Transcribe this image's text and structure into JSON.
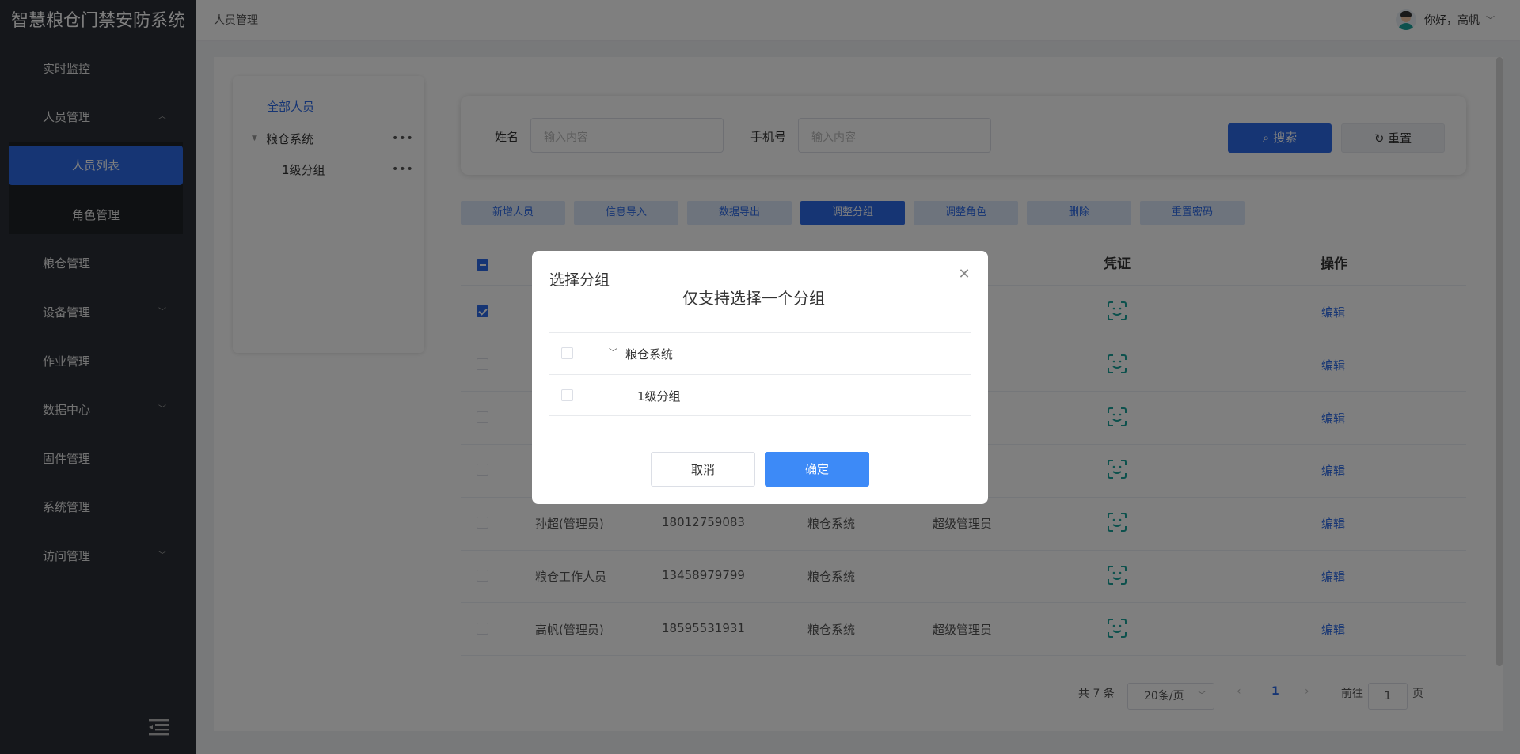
{
  "sidebar": {
    "app_title": "智慧粮仓门禁安防系统",
    "items": [
      {
        "label": "实时监控"
      },
      {
        "label": "人员管理"
      },
      {
        "label": "粮仓管理"
      },
      {
        "label": "设备管理"
      },
      {
        "label": "作业管理"
      },
      {
        "label": "数据中心"
      },
      {
        "label": "固件管理"
      },
      {
        "label": "系统管理"
      },
      {
        "label": "访问管理"
      }
    ],
    "sub_items": [
      {
        "label": "人员列表"
      },
      {
        "label": "角色管理"
      }
    ]
  },
  "topbar": {
    "breadcrumb": "人员管理",
    "greeting": "你好，高帆"
  },
  "tree": {
    "all": "全部人员",
    "root": "粮仓系统",
    "child": "1级分组",
    "more": "•••"
  },
  "search": {
    "name_label": "姓名",
    "name_placeholder": "输入内容",
    "phone_label": "手机号",
    "phone_placeholder": "输入内容",
    "search_btn": "搜索",
    "reset_btn": "重置"
  },
  "toolbar": {
    "add": "新增人员",
    "import": "信息导入",
    "export": "数据导出",
    "adjust_group": "调整分组",
    "adjust_role": "调整角色",
    "delete": "删除",
    "reset_password": "重置密码"
  },
  "table": {
    "headers": {
      "credential": "凭证",
      "action": "操作"
    },
    "rows": [
      {
        "name": "",
        "phone": "",
        "group": "",
        "role": "",
        "action": "编辑",
        "checked": true
      },
      {
        "name": "",
        "phone": "",
        "group": "",
        "role": "",
        "action": "编辑",
        "checked": false
      },
      {
        "name": "",
        "phone": "",
        "group": "",
        "role": "",
        "action": "编辑",
        "checked": false
      },
      {
        "name": "",
        "phone": "",
        "group": "",
        "role": "",
        "action": "编辑",
        "checked": false
      },
      {
        "name": "孙超(管理员)",
        "phone": "18012759083",
        "group": "粮仓系统",
        "role": "超级管理员",
        "action": "编辑",
        "checked": false
      },
      {
        "name": "粮仓工作人员",
        "phone": "13458979799",
        "group": "粮仓系统",
        "role": "",
        "action": "编辑",
        "checked": false
      },
      {
        "name": "高帆(管理员)",
        "phone": "18595531931",
        "group": "粮仓系统",
        "role": "超级管理员",
        "action": "编辑",
        "checked": false
      }
    ]
  },
  "pager": {
    "total": "共 7 条",
    "page_size": "20条/页",
    "prev": "‹",
    "current": "1",
    "next": "›",
    "goto_label": "前往",
    "goto_value": "1",
    "page_unit": "页"
  },
  "dialog": {
    "title": "选择分组",
    "subtitle": "仅支持选择一个分组",
    "tree": [
      {
        "label": "粮仓系统"
      },
      {
        "label": "1级分组"
      }
    ],
    "cancel": "取消",
    "confirm": "确定"
  },
  "colors": {
    "accent": "#2d6be8",
    "sidebar": "#2a2f36",
    "confirm": "#3d8af7",
    "face_icon": "#1aa39a"
  }
}
